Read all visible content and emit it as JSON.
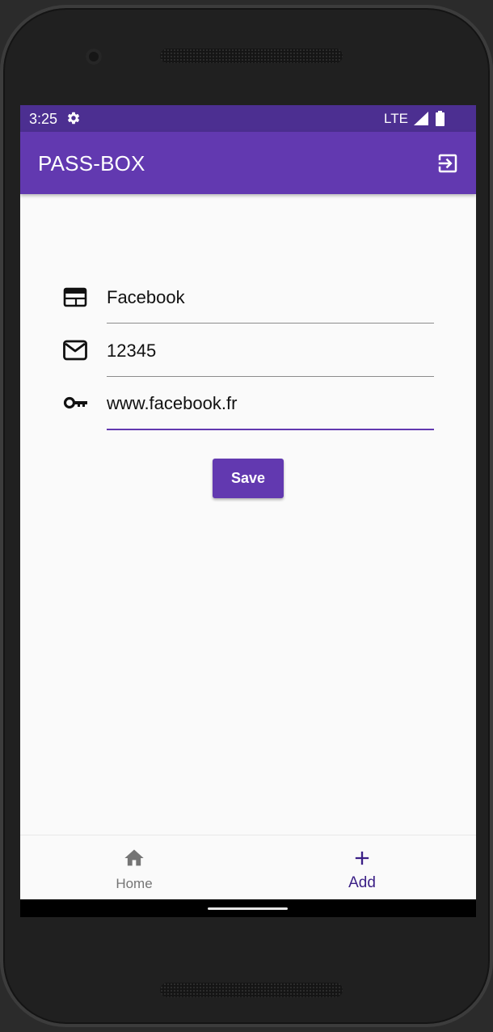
{
  "status_bar": {
    "time": "3:25",
    "network": "LTE",
    "icons": [
      "gear-icon",
      "signal-icon",
      "battery-icon"
    ]
  },
  "app_bar": {
    "title": "PASS-BOX",
    "action_icon": "logout-icon"
  },
  "form": {
    "fields": [
      {
        "icon": "website-icon",
        "value": "Facebook"
      },
      {
        "icon": "email-icon",
        "value": "12345"
      },
      {
        "icon": "key-icon",
        "value": "www.facebook.fr"
      }
    ],
    "save_label": "Save"
  },
  "bottom_nav": {
    "items": [
      {
        "label": "Home",
        "icon": "home-icon",
        "active": false
      },
      {
        "label": "Add",
        "icon": "plus-icon",
        "active": true
      }
    ]
  },
  "colors": {
    "status_bar": "#4c2f91",
    "primary": "#6239b0",
    "active_nav": "#3b1f86",
    "background": "#fafafa"
  }
}
